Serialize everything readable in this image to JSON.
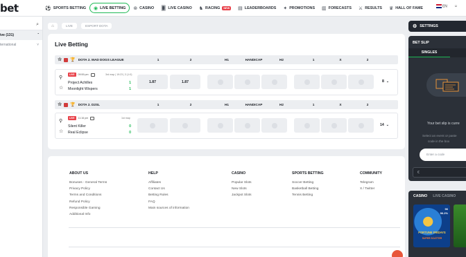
{
  "topnav": {
    "logo": "bet",
    "items": [
      {
        "label": "SPORTS BETTING",
        "icon": "soccer-ball-icon"
      },
      {
        "label": "LIVE BETTING",
        "icon": "live-icon",
        "active": true
      },
      {
        "label": "CASINO",
        "icon": "casino-chip-icon"
      },
      {
        "label": "LIVE CASINO",
        "icon": "cards-icon"
      },
      {
        "label": "RACING",
        "icon": "horse-icon",
        "badge": "NEW"
      },
      {
        "label": "LEADERBOARDS",
        "icon": "leaderboard-icon"
      },
      {
        "label": "PROMOTIONS",
        "icon": "gift-icon"
      },
      {
        "label": "FORECASTS",
        "icon": "forecast-icon"
      },
      {
        "label": "RESULTS",
        "icon": "results-icon"
      },
      {
        "label": "HALL OF FAME",
        "icon": "crown-icon"
      }
    ],
    "lang": "EN"
  },
  "sidebar": {
    "items": [
      {
        "label": "ive (131)"
      },
      {
        "label": "ternational"
      }
    ]
  },
  "breadcrumb": {
    "items": [
      "LIVE",
      "ESPORT DOTA"
    ]
  },
  "main": {
    "title": "Live Betting",
    "leagues": [
      {
        "name": "DOTA 2. MAD DOGS LEAGUE",
        "columns": [
          "1",
          "2",
          "H1",
          "HANDICAP",
          "H2",
          "1",
          "X",
          "2"
        ],
        "match": {
          "status": "LIVE",
          "time": "09:59 pm",
          "extra": "3rd map | 19:23 | 3 (1:0)",
          "team1": "Project Achilles",
          "team2": "Moonlight Wispers",
          "score1": "1",
          "score2": "1",
          "odds": [
            "1.87",
            "1.87"
          ],
          "more": "8"
        }
      },
      {
        "name": "DOTA 2. D2SL",
        "columns": [
          "1",
          "2",
          "H1",
          "HANDICAP",
          "H2",
          "1",
          "X",
          "2"
        ],
        "match": {
          "status": "LIVE",
          "time": "11:16 pm",
          "extra": "1st map",
          "team1": "Silent Killer",
          "team2": "Real Eclipse",
          "score1": "0",
          "score2": "0",
          "odds": [],
          "more": "14"
        }
      }
    ]
  },
  "footer": {
    "columns": [
      {
        "title": "ABOUT US",
        "links": [
          "Bonuses - General Terms",
          "Privacy Policy",
          "Terms and Conditions",
          "Refund Policy",
          "Responsible Gaming",
          "Additional Info"
        ]
      },
      {
        "title": "HELP",
        "links": [
          "Affiliates",
          "Contact Us",
          "Betting Rules",
          "FAQ",
          "Main sources of information"
        ]
      },
      {
        "title": "CASINO",
        "links": [
          "Popular Slots",
          "New Slots",
          "Jackpot Slots"
        ]
      },
      {
        "title": "SPORTS BETTING",
        "links": [
          "Soccer Betting",
          "Basketball Betting",
          "Tennis Betting"
        ]
      },
      {
        "title": "COMMUNITY",
        "links": [
          "Telegram",
          "X / Twitter"
        ]
      }
    ]
  },
  "rightpanel": {
    "settings": "SETTINGS",
    "betslip_title": "BET SLIP",
    "tab": "SINGLES",
    "empty": "Your bet slip is curre",
    "hint1": "Select an event or paste",
    "hint2": "code in the box",
    "code_placeholder": "Enter a code",
    "currency": "€",
    "casino_tabs": [
      "CASINO",
      "LIVE CASINO"
    ],
    "thumb_pct1": "96",
    "thumb_pct2": "96.2%",
    "thumb_title": "FORTUNE FRIDAYS",
    "thumb_sub": "SUPER SCATTER"
  }
}
